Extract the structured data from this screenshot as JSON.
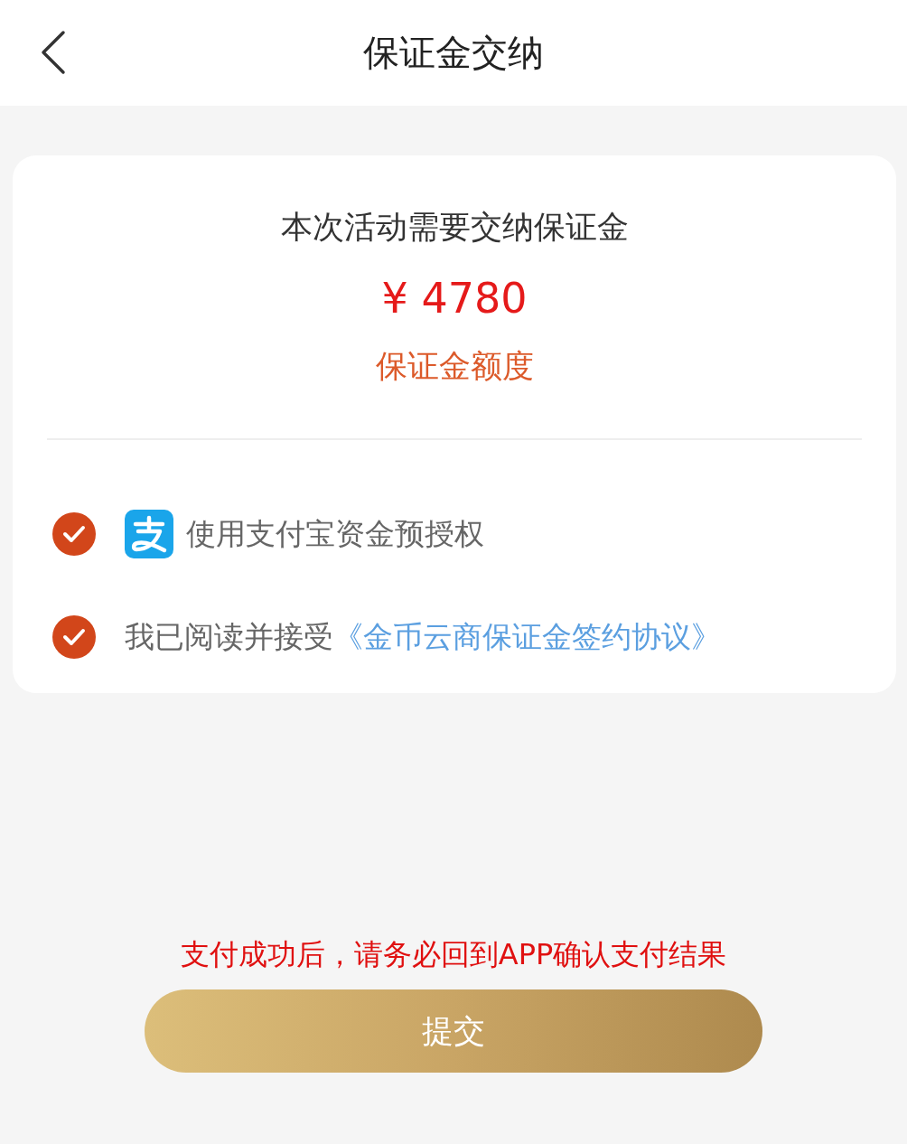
{
  "header": {
    "title": "保证金交纳"
  },
  "deposit": {
    "heading": "本次活动需要交纳保证金",
    "amount": "¥ 4780",
    "label": "保证金额度"
  },
  "options": [
    {
      "kind": "alipay",
      "checked": true,
      "text": "使用支付宝资金预授权"
    },
    {
      "kind": "agreement",
      "checked": true,
      "text": "我已阅读并接受",
      "link": "《金币云商保证金签约协议》"
    }
  ],
  "notice": "支付成功后，请务必回到APP确认支付结果",
  "submit_button": "提交"
}
